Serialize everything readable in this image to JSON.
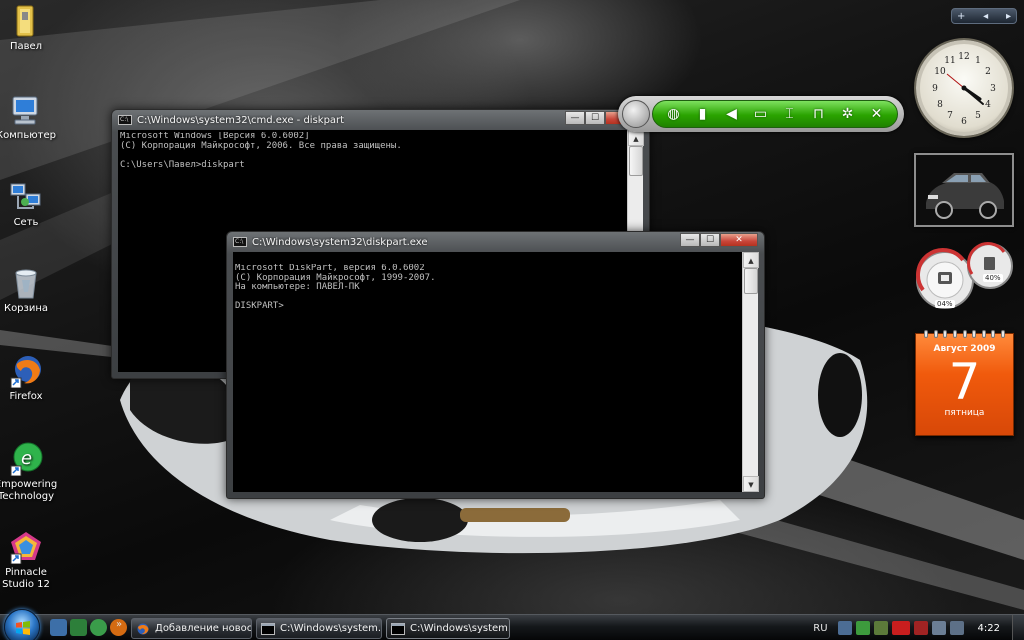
{
  "desktop_icons": [
    {
      "label": "Павел",
      "icon": "user-folder-icon"
    },
    {
      "label": "Компьютер",
      "icon": "computer-icon"
    },
    {
      "label": "Сеть",
      "icon": "network-icon"
    },
    {
      "label": "Корзина",
      "icon": "recycle-bin-icon"
    },
    {
      "label": "Firefox",
      "icon": "firefox-icon"
    },
    {
      "label": "Empowering Technology",
      "icon": "empowering-technology-icon"
    },
    {
      "label": "Pinnacle Studio 12",
      "icon": "pinnacle-studio-icon"
    }
  ],
  "cmd_window": {
    "title": "C:\\Windows\\system32\\cmd.exe - diskpart",
    "icon_text": "C:\\",
    "lines": "Microsoft Windows [Версия 6.0.6002]\n(С) Корпорация Майкрософт, 2006. Все права защищены.\n\nC:\\Users\\Павел>diskpart",
    "minimize": "—",
    "maximize": "☐",
    "close": "✕"
  },
  "diskpart_window": {
    "title": "C:\\Windows\\system32\\diskpart.exe",
    "icon_text": "C:\\",
    "lines": "Microsoft DiskPart, версия 6.0.6002\n(С) Корпорация Майкрософт, 1999-2007.\nНа компьютере: ПАВЕЛ-ПК\n\nDISKPART>",
    "minimize": "—",
    "maximize": "☐",
    "close": "✕"
  },
  "scroll_arrows": {
    "up": "▲",
    "down": "▼"
  },
  "gadget_toolbar": {
    "icons": [
      {
        "name": "globe-icon",
        "glyph": "◍"
      },
      {
        "name": "battery-icon",
        "glyph": "▮"
      },
      {
        "name": "speaker-icon",
        "glyph": "◀"
      },
      {
        "name": "radio-icon",
        "glyph": "▭"
      },
      {
        "name": "usb-icon",
        "glyph": "⌶"
      },
      {
        "name": "lock-icon",
        "glyph": "⊓"
      },
      {
        "name": "gear-icon",
        "glyph": "✲"
      },
      {
        "name": "close-icon",
        "glyph": "✕"
      }
    ]
  },
  "gadget_bar": {
    "add": "+",
    "prev": "◂",
    "next": "▸"
  },
  "cpu_gadget": {
    "cpu": "04%",
    "memory": "40%"
  },
  "calendar": {
    "month": "Август 2009",
    "day": "7",
    "weekday": "пятница"
  },
  "taskbar": {
    "more": "»",
    "buttons": [
      {
        "label": "Добавление новос...",
        "icon": "firefox-icon"
      },
      {
        "label": "C:\\Windows\\system...",
        "icon": "cmd-icon"
      },
      {
        "label": "C:\\Windows\\system...",
        "icon": "cmd-icon"
      }
    ],
    "language": "RU",
    "time": "4:22"
  },
  "colors": {
    "toolbar_green": "#2aa300",
    "calendar_orange": "#f05a0c",
    "console_text": "#c0c0c0"
  }
}
